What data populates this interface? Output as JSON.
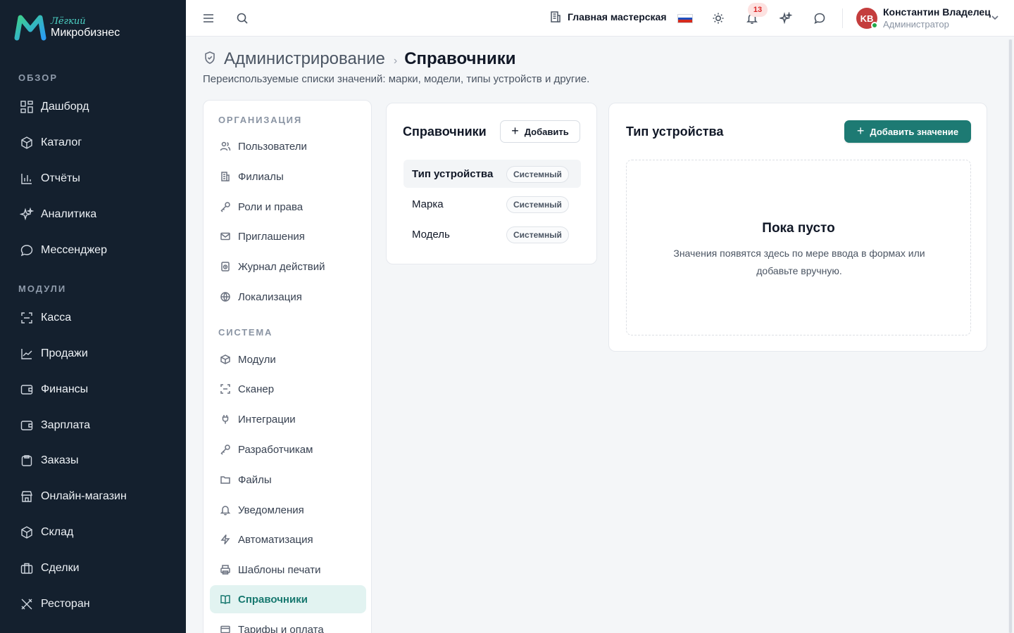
{
  "app": {
    "logo_small": "Лёгкий",
    "logo_main": "Микробизнес"
  },
  "sidebar": {
    "section_overview": "ОБЗОР",
    "section_modules": "МОДУЛИ",
    "overview_items": [
      {
        "label": "Дашборд",
        "icon": "dashboard-icon"
      },
      {
        "label": "Каталог",
        "icon": "catalog-icon"
      },
      {
        "label": "Отчёты",
        "icon": "reports-icon"
      },
      {
        "label": "Аналитика",
        "icon": "sparkles-icon"
      },
      {
        "label": "Мессенджер",
        "icon": "chat-icon"
      }
    ],
    "module_items": [
      {
        "label": "Касса",
        "icon": "scan-icon"
      },
      {
        "label": "Продажи",
        "icon": "chart-line-icon"
      },
      {
        "label": "Финансы",
        "icon": "wallet-icon"
      },
      {
        "label": "Зарплата",
        "icon": "wallet-icon"
      },
      {
        "label": "Заказы",
        "icon": "clipboard-icon"
      },
      {
        "label": "Онлайн-магазин",
        "icon": "store-icon"
      },
      {
        "label": "Склад",
        "icon": "box-icon"
      },
      {
        "label": "Сделки",
        "icon": "briefcase-icon"
      },
      {
        "label": "Ресторан",
        "icon": "utensils-icon"
      }
    ]
  },
  "topbar": {
    "workshop": "Главная мастерская",
    "notifications_count": "13",
    "user_initials": "KB",
    "user_name": "Константин Владелец",
    "user_role": "Администратор"
  },
  "page": {
    "breadcrumb_parent": "Администрирование",
    "breadcrumb_sep": "›",
    "breadcrumb_current": "Справочники",
    "subtitle": "Переиспользуемые списки значений: марки, модели, типы устройств и другие."
  },
  "settings_nav": {
    "section_org": "ОРГАНИЗАЦИЯ",
    "section_system": "СИСТЕМА",
    "org_items": [
      {
        "label": "Пользователи",
        "icon": "users-icon"
      },
      {
        "label": "Филиалы",
        "icon": "building-icon"
      },
      {
        "label": "Роли и права",
        "icon": "key-icon"
      },
      {
        "label": "Приглашения",
        "icon": "mail-icon"
      },
      {
        "label": "Журнал действий",
        "icon": "history-icon"
      },
      {
        "label": "Локализация",
        "icon": "globe-icon"
      }
    ],
    "system_items": [
      {
        "label": "Модули",
        "icon": "box-icon"
      },
      {
        "label": "Сканер",
        "icon": "scan-icon"
      },
      {
        "label": "Интеграции",
        "icon": "plug-icon"
      },
      {
        "label": "Разработчикам",
        "icon": "key-icon"
      },
      {
        "label": "Файлы",
        "icon": "folder-icon"
      },
      {
        "label": "Уведомления",
        "icon": "bell-icon"
      },
      {
        "label": "Автоматизация",
        "icon": "zap-icon"
      },
      {
        "label": "Шаблоны печати",
        "icon": "printer-icon"
      },
      {
        "label": "Справочники",
        "icon": "book-icon",
        "active": true
      },
      {
        "label": "Тарифы и оплата",
        "icon": "card-icon"
      }
    ]
  },
  "directories": {
    "title": "Справочники",
    "add_label": "Добавить",
    "items": [
      {
        "name": "Тип устройства",
        "tag": "Системный",
        "active": true
      },
      {
        "name": "Марка",
        "tag": "Системный"
      },
      {
        "name": "Модель",
        "tag": "Системный"
      }
    ]
  },
  "values": {
    "title": "Тип устройства",
    "add_label": "Добавить значение",
    "empty_title": "Пока пусто",
    "empty_text": "Значения появятся здесь по мере ввода в формах или добавьте вручную."
  },
  "colors": {
    "sidebar_bg": "#14202e",
    "accent": "#1d7a73",
    "active_bg": "#e2f3f1",
    "badge_bg": "#fde2e1",
    "badge_text": "#dc2626"
  }
}
